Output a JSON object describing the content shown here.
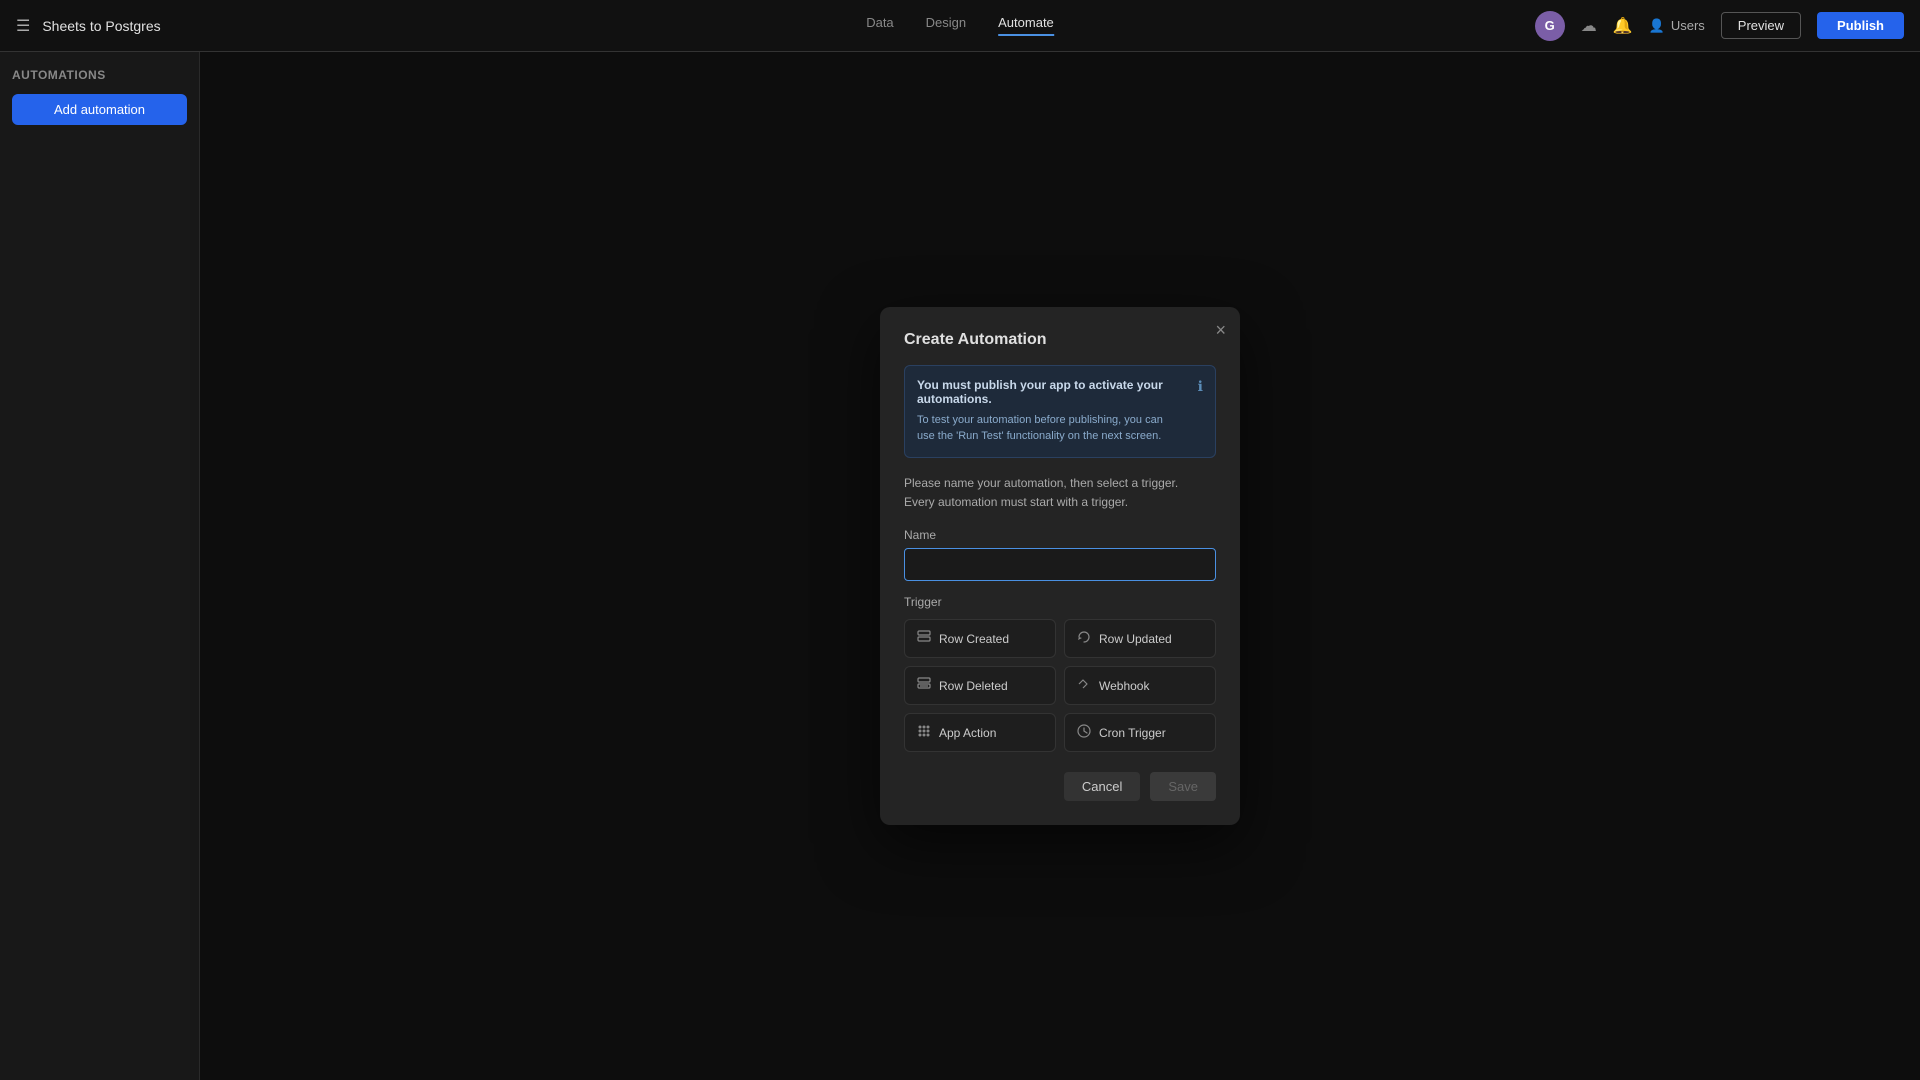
{
  "header": {
    "app_title": "Sheets to Postgres",
    "nav": [
      {
        "label": "Data",
        "active": false
      },
      {
        "label": "Design",
        "active": false
      },
      {
        "label": "Automate",
        "active": true
      }
    ],
    "preview_label": "Preview",
    "publish_label": "Publish",
    "users_label": "Users",
    "avatar_letter": "G"
  },
  "sidebar": {
    "title": "Automations",
    "add_button_label": "Add automation"
  },
  "modal": {
    "title": "Create Automation",
    "close_icon": "×",
    "banner": {
      "bold_text": "You must publish your app to activate your automations.",
      "body_text": "To test your automation before publishing, you can use the 'Run Test' functionality on the next screen."
    },
    "desc_line1": "Please name your automation, then select a trigger.",
    "desc_line2": "Every automation must start with a trigger.",
    "name_label": "Name",
    "name_placeholder": "",
    "trigger_label": "Trigger",
    "triggers": [
      {
        "id": "row-created",
        "label": "Row Created",
        "icon": "⊞"
      },
      {
        "id": "row-updated",
        "label": "Row Updated",
        "icon": "↻"
      },
      {
        "id": "row-deleted",
        "label": "Row Deleted",
        "icon": "⊟"
      },
      {
        "id": "webhook",
        "label": "Webhook",
        "icon": "➤"
      },
      {
        "id": "app-action",
        "label": "App Action",
        "icon": "⊞"
      },
      {
        "id": "cron-trigger",
        "label": "Cron Trigger",
        "icon": "⏱"
      }
    ],
    "cancel_label": "Cancel",
    "save_label": "Save"
  }
}
